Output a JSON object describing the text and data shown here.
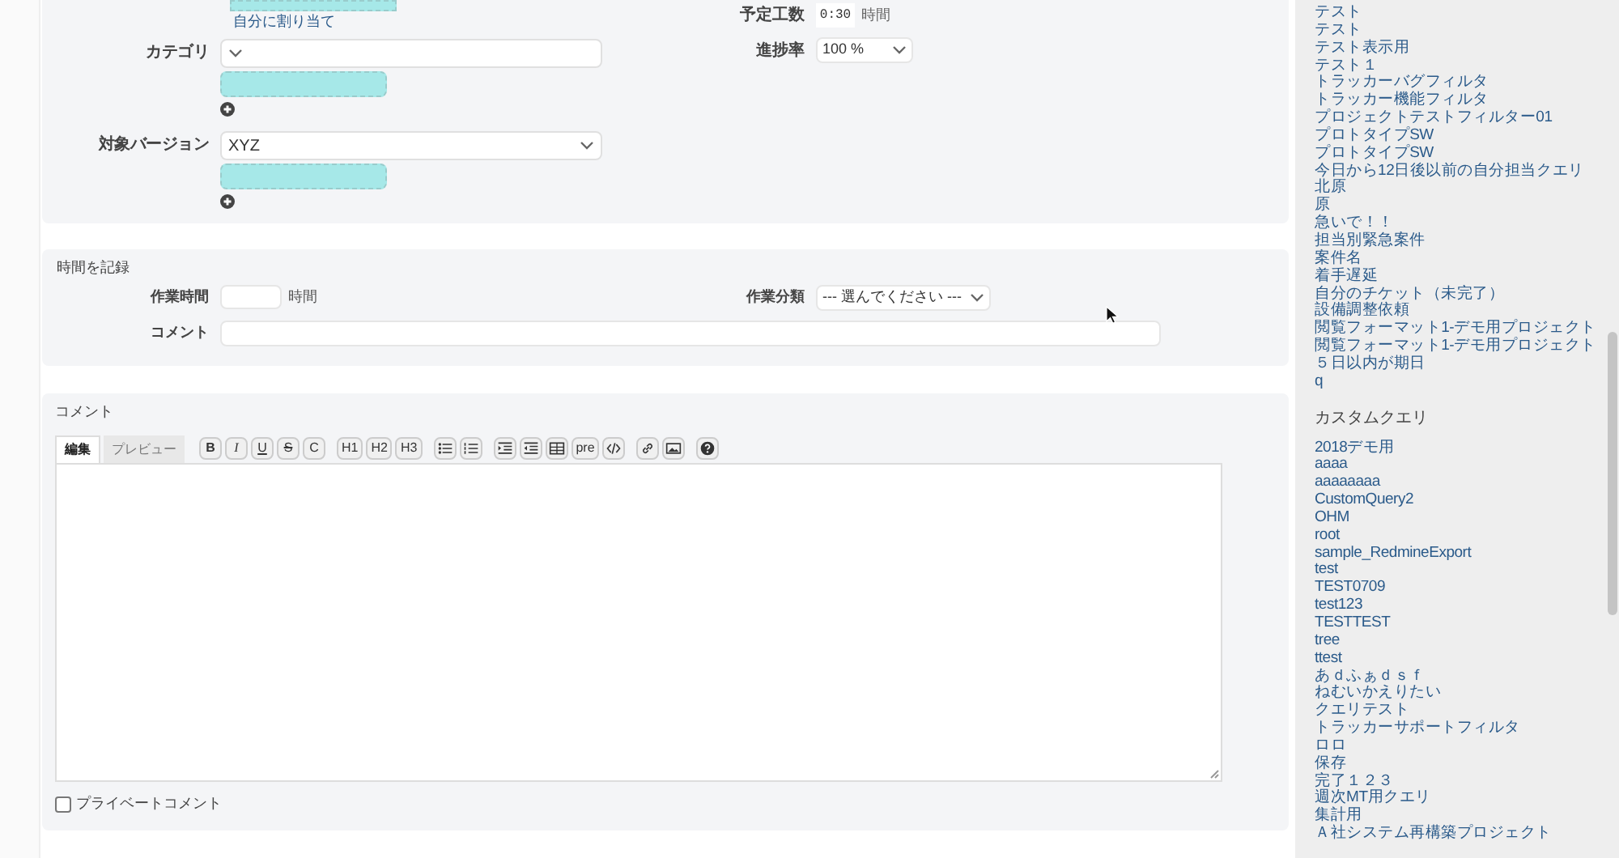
{
  "attributes": {
    "assign_to_me": "自分に割り当て",
    "left_fields": [
      {
        "label": "カテゴリ"
      },
      {
        "label": "対象バージョン",
        "value": "XYZ"
      }
    ],
    "estimated": {
      "label": "予定工数",
      "value": "0:30",
      "unit": "時間"
    },
    "progress": {
      "label": "進捗率",
      "value": "100 %"
    }
  },
  "time_entry": {
    "title": "時間を記録",
    "hours": {
      "label": "作業時間",
      "unit": "時間"
    },
    "activity": {
      "label": "作業分類",
      "value": "--- 選んでください ---"
    },
    "comment": {
      "label": "コメント"
    }
  },
  "notes": {
    "title": "コメント",
    "tabs": [
      {
        "label": "編集",
        "selected": true
      },
      {
        "label": "プレビュー",
        "selected": false
      }
    ],
    "toolbar": [
      [
        {
          "kind": "bold",
          "label": "B"
        },
        {
          "kind": "italic",
          "label": "I"
        },
        {
          "kind": "underline",
          "label": "U"
        },
        {
          "kind": "strike",
          "label": "S"
        },
        {
          "kind": "text",
          "label": "C"
        }
      ],
      [
        {
          "kind": "text",
          "label": "H1"
        },
        {
          "kind": "text",
          "label": "H2"
        },
        {
          "kind": "text",
          "label": "H3"
        }
      ],
      [
        {
          "kind": "ul"
        },
        {
          "kind": "ol"
        }
      ],
      [
        {
          "kind": "indent"
        },
        {
          "kind": "outdent"
        },
        {
          "kind": "table"
        },
        {
          "kind": "text",
          "label": "pre"
        },
        {
          "kind": "code"
        }
      ],
      [
        {
          "kind": "link"
        },
        {
          "kind": "image"
        }
      ],
      [
        {
          "kind": "help"
        }
      ]
    ],
    "private": {
      "label": "プライベートコメント",
      "checked": false
    }
  },
  "sidebar": {
    "queries": [
      "テスト",
      "テスト",
      "テスト表示用",
      "テスト１",
      "トラッカーバグフィルタ",
      "トラッカー機能フィルタ",
      "プロジェクトテストフィルター01",
      "プロトタイプSW",
      "プロトタイプSW",
      "今日から12日後以前の自分担当クエリ",
      "北原",
      "原",
      "急いで！！",
      "担当別緊急案件",
      "案件名",
      "着手遅延",
      "自分のチケット（未完了）",
      "設備調整依頼",
      "閲覧フォーマット1-デモ用プロジェクト",
      "閲覧フォーマット1-デモ用プロジェクト",
      "５日以内が期日",
      "q"
    ],
    "custom_title": "カスタムクエリ",
    "custom_queries": [
      "2018デモ用",
      "aaaa",
      "aaaaaaaa",
      "CustomQuery2",
      "OHM",
      "root",
      "sample_RedmineExport",
      "test",
      "TEST0709",
      "test123",
      "TESTTEST",
      "tree",
      "ttest",
      "あｄふぁｄｓｆ",
      "ねむいかえりたい",
      "クエリテスト",
      "トラッカーサポートフィルタ",
      "ロロ",
      "保存",
      "完了１２３",
      "週次MT用クエリ",
      "集計用",
      "Ａ社システム再構築プロジェクト"
    ]
  }
}
